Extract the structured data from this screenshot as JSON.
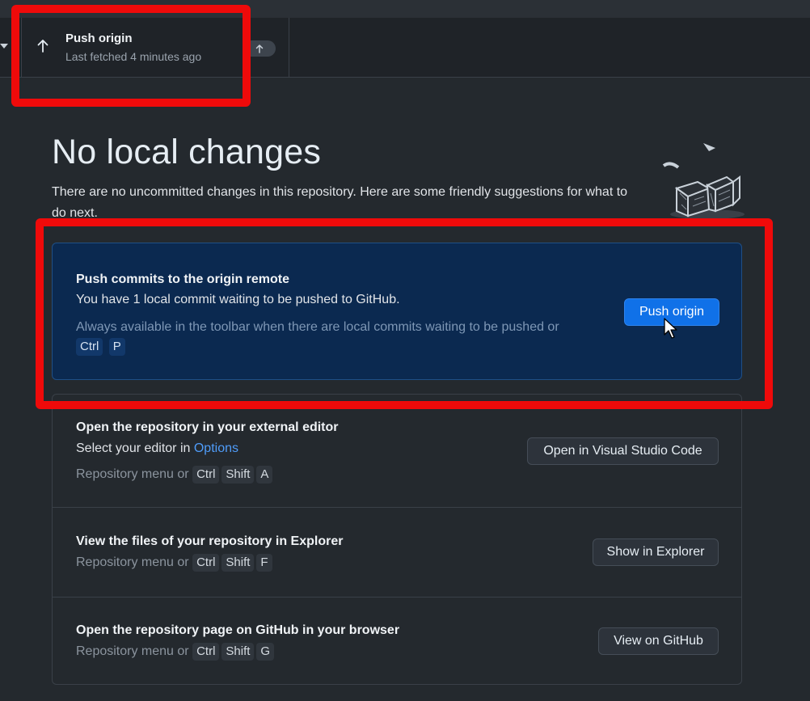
{
  "toolbar": {
    "push_title": "Push origin",
    "push_subtitle": "Last fetched 4 minutes ago",
    "push_icon": "arrow-up-icon",
    "badge_icon": "arrow-up-icon"
  },
  "blankslate": {
    "title": "No local changes",
    "description": "There are no uncommitted changes in this repository. Here are some friendly suggestions for what to do next."
  },
  "cards": {
    "push": {
      "title": "Push commits to the origin remote",
      "text": "You have 1 local commit waiting to be pushed to GitHub.",
      "hint": "Always available in the toolbar when there are local commits waiting to be pushed or",
      "keys": [
        "Ctrl",
        "P"
      ],
      "button": "Push origin"
    },
    "editor": {
      "title": "Open the repository in your external editor",
      "text_prefix": "Select your editor in ",
      "text_link": "Options",
      "hint": "Repository menu or",
      "keys": [
        "Ctrl",
        "Shift",
        "A"
      ],
      "button": "Open in Visual Studio Code"
    },
    "explorer": {
      "title": "View the files of your repository in Explorer",
      "hint": "Repository menu or",
      "keys": [
        "Ctrl",
        "Shift",
        "F"
      ],
      "button": "Show in Explorer"
    },
    "github": {
      "title": "Open the repository page on GitHub in your browser",
      "hint": "Repository menu or",
      "keys": [
        "Ctrl",
        "Shift",
        "G"
      ],
      "button": "View on GitHub"
    }
  },
  "colors": {
    "highlight": "#ef0a0a",
    "primary_button": "#1071e8",
    "primary_card": "#0b2950",
    "link": "#4f9cf9"
  }
}
